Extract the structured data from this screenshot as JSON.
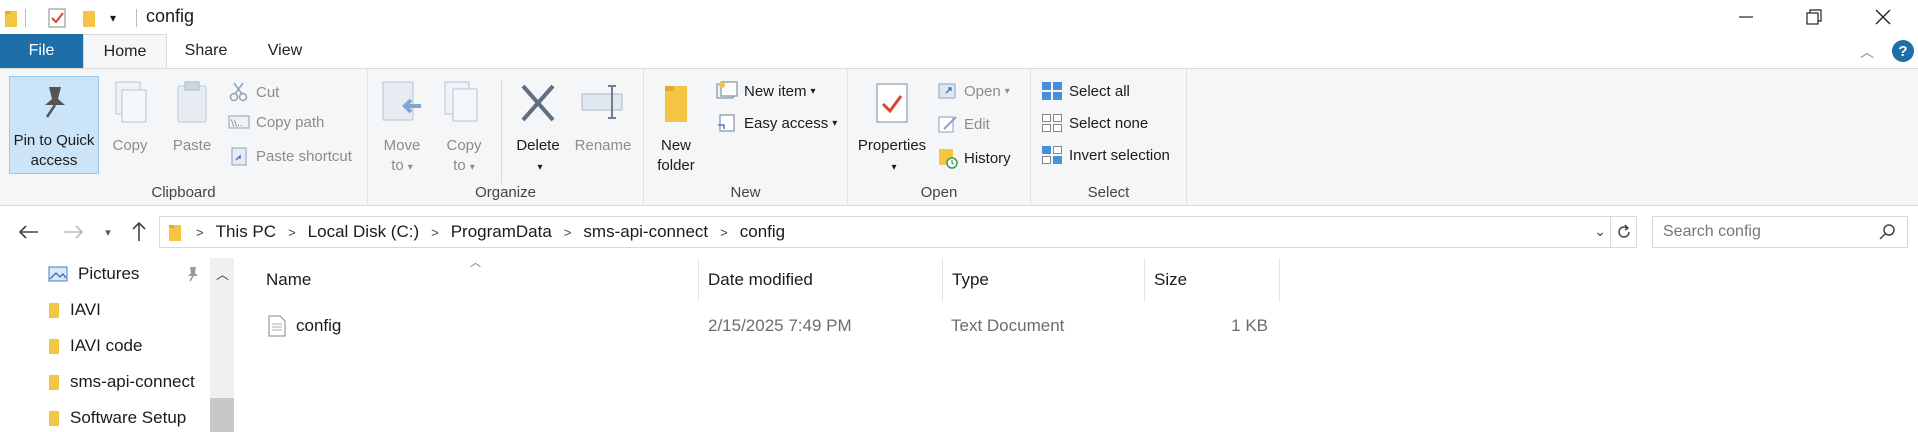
{
  "window": {
    "title": "config",
    "controls": {
      "minimize": "minimize-icon",
      "maximize": "restore-icon",
      "close": "close-icon"
    }
  },
  "ribbon_tabs": {
    "file": "File",
    "home": "Home",
    "share": "Share",
    "view": "View"
  },
  "ribbon": {
    "clipboard": {
      "label": "Clipboard",
      "pin_line1": "Pin to Quick",
      "pin_line2": "access",
      "copy": "Copy",
      "paste": "Paste",
      "cut": "Cut",
      "copy_path": "Copy path",
      "paste_shortcut": "Paste shortcut"
    },
    "organize": {
      "label": "Organize",
      "move_line1": "Move",
      "move_line2": "to",
      "copy_line1": "Copy",
      "copy_line2": "to",
      "delete": "Delete",
      "rename": "Rename"
    },
    "new": {
      "label": "New",
      "folder_line1": "New",
      "folder_line2": "folder",
      "new_item": "New item",
      "easy_access": "Easy access"
    },
    "open": {
      "label": "Open",
      "properties": "Properties",
      "open": "Open",
      "edit": "Edit",
      "history": "History"
    },
    "select": {
      "label": "Select",
      "select_all": "Select all",
      "select_none": "Select none",
      "invert": "Invert selection"
    }
  },
  "address": {
    "breadcrumbs": [
      "This PC",
      "Local Disk (C:)",
      "ProgramData",
      "sms-api-connect",
      "config"
    ],
    "search_placeholder": "Search config"
  },
  "nav_pane": {
    "items": [
      "Pictures",
      "IAVI",
      "IAVI code",
      "sms-api-connect",
      "Software Setup"
    ]
  },
  "file_list": {
    "columns": {
      "name": "Name",
      "date": "Date modified",
      "type": "Type",
      "size": "Size"
    },
    "rows": [
      {
        "name": "config",
        "date": "2/15/2025 7:49 PM",
        "type": "Text Document",
        "size": "1 KB"
      }
    ]
  },
  "colors": {
    "accent": "#1e6fa8",
    "folder": "#f4c542",
    "selection": "#cce4f7"
  }
}
